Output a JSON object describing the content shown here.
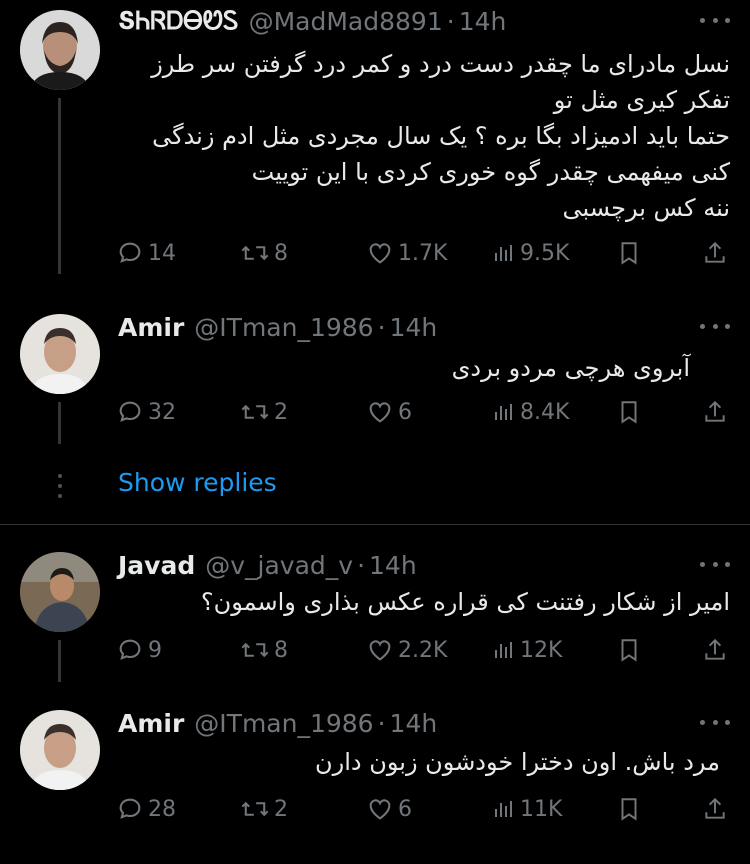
{
  "colors": {
    "background": "#000000",
    "text": "#e7e9ea",
    "muted": "#71767b",
    "link": "#1d9bf0",
    "line": "#333639"
  },
  "tweets": [
    {
      "name": "ՏᏂᏒᎠᎾᏬᏚ",
      "handle": "@MadMad8891",
      "dot": "·",
      "time": "14h",
      "lines": [
        "نسل مادرای ما چقدر دست درد و کمر درد گرفتن سر طرز",
        "تفکر کیری مثل تو",
        "حتما باید ادمیزاد بگا بره ؟ یک سال مجردی مثل ادم زندگی",
        "کنی میفهمی چقدر گوه خوری کردی با این توییت",
        "ننه کس برچسبی"
      ],
      "replies": "14",
      "retweets": "8",
      "likes": "1.7K",
      "views": "9.5K"
    },
    {
      "name": "Amir",
      "handle": "@ITman_1986",
      "dot": "·",
      "time": "14h",
      "lines": [
        "آبروی هرچی مردو بردی"
      ],
      "replies": "32",
      "retweets": "2",
      "likes": "6",
      "views": "8.4K"
    },
    {
      "name": "Javad",
      "handle": "@v_javad_v",
      "dot": "·",
      "time": "14h",
      "lines": [
        "امیر از شکار رفتنت کی قراره عکس بذاری واسمون؟"
      ],
      "replies": "9",
      "retweets": "8",
      "likes": "2.2K",
      "views": "12K"
    },
    {
      "name": "Amir",
      "handle": "@ITman_1986",
      "dot": "·",
      "time": "14h",
      "lines": [
        "مرد باش.  اون دخترا خودشون زبون دارن"
      ],
      "replies": "28",
      "retweets": "2",
      "likes": "6",
      "views": "11K"
    }
  ],
  "show_replies_label": "Show replies",
  "icons": [
    "reply-icon",
    "retweet-icon",
    "like-icon",
    "views-icon",
    "bookmark-icon",
    "share-icon",
    "more-icon"
  ]
}
